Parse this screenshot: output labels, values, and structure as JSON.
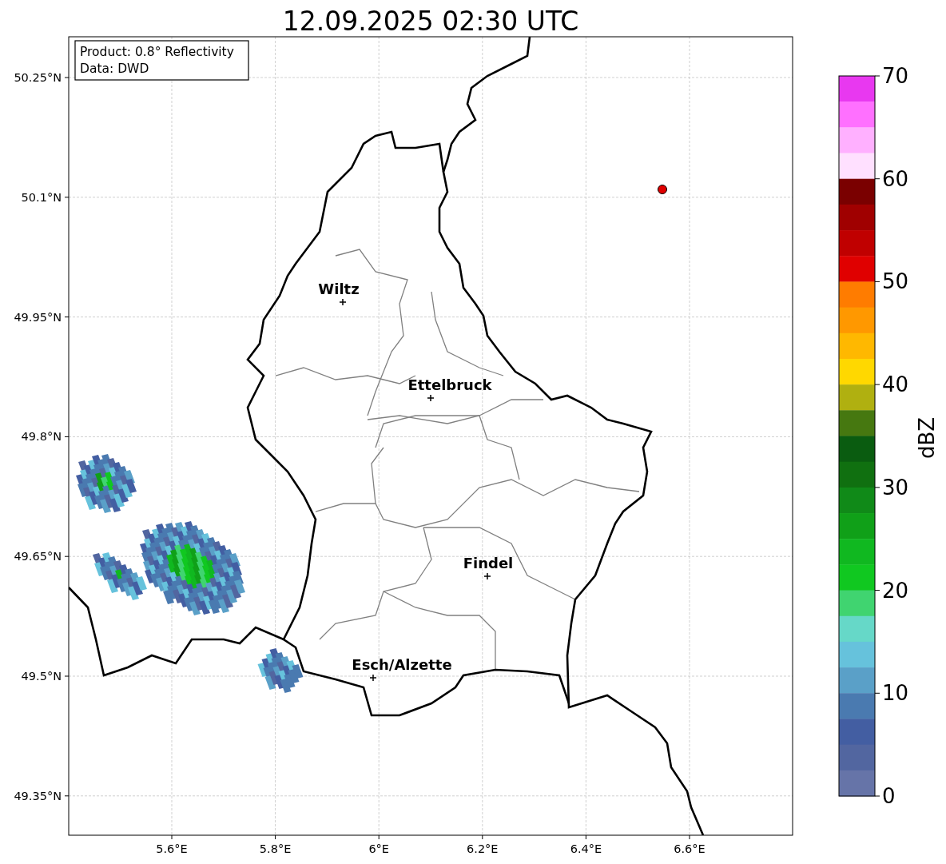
{
  "title": "12.09.2025 02:30 UTC",
  "info_box": [
    "Product: 0.8° Reflectivity",
    "Data: DWD"
  ],
  "map": {
    "lat_ticks": [
      "50.25°N",
      "50.1°N",
      "49.95°N",
      "49.8°N",
      "49.65°N",
      "49.5°N",
      "49.35°N"
    ],
    "lon_ticks": [
      "5.6°E",
      "5.8°E",
      "6°E",
      "6.2°E",
      "6.4°E",
      "6.6°E"
    ],
    "cities": [
      {
        "name": "Wiltz"
      },
      {
        "name": "Ettelbruck"
      },
      {
        "name": "Findel"
      },
      {
        "name": "Esch/Alzette"
      }
    ]
  },
  "colorbar": {
    "label": "dBZ",
    "ticks": [
      "70",
      "60",
      "50",
      "40",
      "30",
      "20",
      "10",
      "0"
    ],
    "bands": [
      {
        "color": "#e838f0"
      },
      {
        "color": "#ff70ff"
      },
      {
        "color": "#ffb0ff"
      },
      {
        "color": "#ffe0ff"
      },
      {
        "color": "#7a0000"
      },
      {
        "color": "#a00000"
      },
      {
        "color": "#c00000"
      },
      {
        "color": "#e00000"
      },
      {
        "color": "#ff7c00"
      },
      {
        "color": "#ff9800"
      },
      {
        "color": "#ffb800"
      },
      {
        "color": "#ffd800"
      },
      {
        "color": "#b0b010"
      },
      {
        "color": "#467810"
      },
      {
        "color": "#0a5c10"
      },
      {
        "color": "#107010"
      },
      {
        "color": "#108a18"
      },
      {
        "color": "#10a018"
      },
      {
        "color": "#10b820"
      },
      {
        "color": "#10c820"
      },
      {
        "color": "#40d470"
      },
      {
        "color": "#66d8c8"
      },
      {
        "color": "#66c2dc"
      },
      {
        "color": "#5aa0c8"
      },
      {
        "color": "#4a7ab0"
      },
      {
        "color": "#435ea2"
      },
      {
        "color": "#5266a0"
      },
      {
        "color": "#6674a8"
      }
    ]
  }
}
